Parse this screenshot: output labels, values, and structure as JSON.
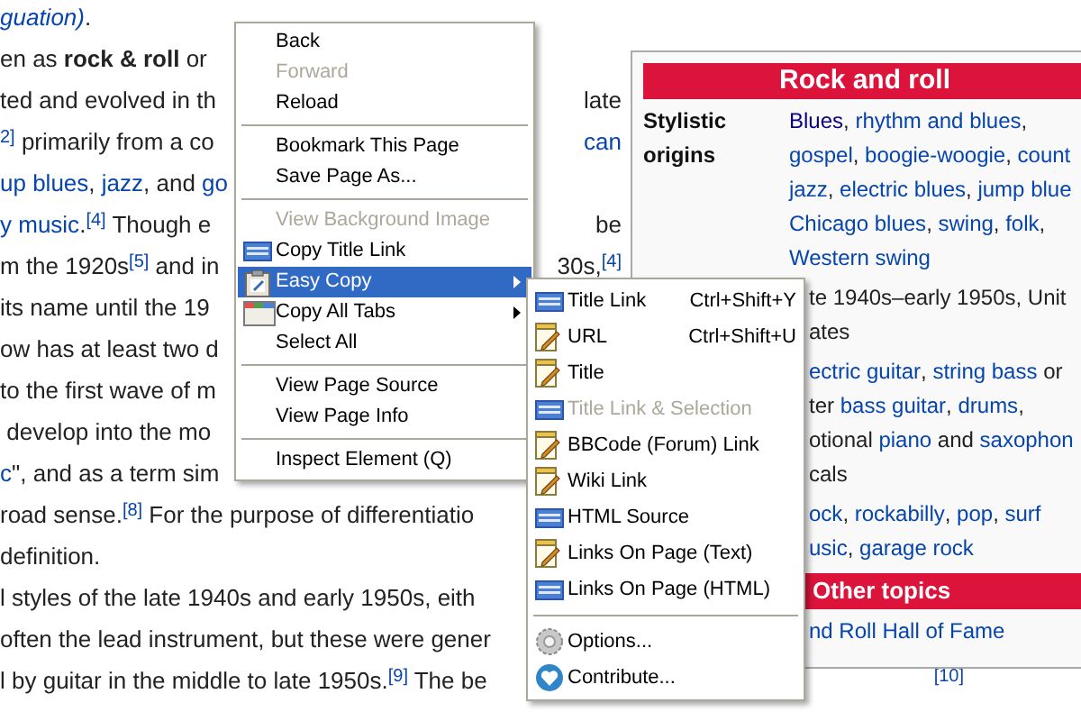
{
  "article": {
    "lines": [
      {
        "segments": [
          {
            "text": "guation)",
            "kind": "italic_link"
          },
          {
            "text": ".",
            "kind": "plain"
          }
        ]
      },
      {
        "segments": [
          {
            "text": "en as ",
            "kind": "plain"
          },
          {
            "text": "rock & roll",
            "kind": "bold"
          },
          {
            "text": " or",
            "kind": "plain"
          }
        ]
      },
      {
        "segments": [
          {
            "text": "ted and evolved in th",
            "kind": "plain"
          }
        ],
        "right": [
          {
            "text": "late",
            "kind": "plain"
          }
        ]
      },
      {
        "segments": [
          {
            "text": "2]",
            "kind": "sup"
          },
          {
            "text": " primarily from a co",
            "kind": "plain"
          }
        ],
        "right": [
          {
            "text": "can",
            "kind": "link"
          }
        ]
      },
      {
        "segments": [
          {
            "text": "up blues",
            "kind": "link"
          },
          {
            "text": ", ",
            "kind": "plain"
          },
          {
            "text": "jazz",
            "kind": "link"
          },
          {
            "text": ", and ",
            "kind": "plain"
          },
          {
            "text": "go",
            "kind": "link"
          }
        ]
      },
      {
        "segments": [
          {
            "text": "y music",
            "kind": "link",
            "after": "."
          },
          {
            "text": "[4]",
            "kind": "sup"
          },
          {
            "text": " Though e",
            "kind": "plain"
          }
        ],
        "right": [
          {
            "text": "be",
            "kind": "plain"
          }
        ]
      },
      {
        "segments": [
          {
            "text": "m the 1920s",
            "kind": "plain"
          },
          {
            "text": "[5]",
            "kind": "sup"
          },
          {
            "text": " and in",
            "kind": "plain"
          }
        ],
        "right": [
          {
            "text": "30s,",
            "kind": "plain"
          },
          {
            "text": "[4]",
            "kind": "sup"
          }
        ]
      },
      {
        "segments": [
          {
            "text": "its name until the 19",
            "kind": "plain"
          }
        ]
      },
      {
        "segments": [
          {
            "text": "ow has at least two d",
            "kind": "plain"
          }
        ]
      },
      {
        "segments": [
          {
            "text": "to the first wave of m",
            "kind": "plain"
          }
        ]
      },
      {
        "segments": [
          {
            "text": " develop into the mo",
            "kind": "plain"
          }
        ]
      },
      {
        "segments": [
          {
            "text": "c",
            "kind": "link"
          },
          {
            "text": "\", and as a term sim",
            "kind": "plain"
          }
        ]
      },
      {
        "segments": [
          {
            "text": "road sense.",
            "kind": "plain"
          },
          {
            "text": "[8]",
            "kind": "sup"
          },
          {
            "text": " For the purpose of differentiatio",
            "kind": "plain"
          }
        ]
      },
      {
        "segments": [
          {
            "text": "definition.",
            "kind": "plain"
          }
        ]
      },
      {
        "segments": [
          {
            "text": "l styles of the late 1940s and early 1950s, eith",
            "kind": "plain"
          }
        ]
      },
      {
        "segments": [
          {
            "text": "often the lead instrument, but these were gener",
            "kind": "plain"
          }
        ]
      }
    ],
    "last_line": {
      "segments": [
        {
          "text": "l by guitar in the middle to late 1950s.",
          "kind": "plain"
        },
        {
          "text": "[9]",
          "kind": "sup"
        },
        {
          "text": " The be",
          "kind": "plain"
        }
      ],
      "right": [
        {
          "text": "[10]",
          "kind": "sup"
        }
      ]
    }
  },
  "infobox": {
    "title": "Rock and roll",
    "rows": [
      {
        "label": "Stylistic origins",
        "lines": [
          [
            {
              "text": "Blues",
              "kind": "visited",
              "after": ", "
            },
            {
              "text": "rhythm and blues",
              "kind": "link",
              "after": ","
            }
          ],
          [
            {
              "text": "gospel",
              "kind": "link",
              "after": ", "
            },
            {
              "text": "boogie-woogie",
              "kind": "link",
              "after": ", "
            },
            {
              "text": "count",
              "kind": "link"
            }
          ],
          [
            {
              "text": "jazz",
              "kind": "link",
              "after": ", "
            },
            {
              "text": "electric blues",
              "kind": "link",
              "after": ", "
            },
            {
              "text": "jump blue",
              "kind": "link"
            }
          ],
          [
            {
              "text": "Chicago blues",
              "kind": "link",
              "after": ", "
            },
            {
              "text": "swing",
              "kind": "link",
              "after": ", "
            },
            {
              "text": "folk",
              "kind": "link",
              "after": ","
            }
          ],
          [
            {
              "text": "Western swing",
              "kind": "link"
            }
          ]
        ]
      },
      {
        "lines": [
          [
            {
              "text": "te 1940s–early 1950s, Unit",
              "kind": "plain"
            }
          ],
          [
            {
              "text": "ates",
              "kind": "plain"
            }
          ]
        ]
      },
      {
        "lines": [
          [
            {
              "text": "ectric guitar",
              "kind": "link"
            },
            {
              "text": ", ",
              "kind": "plain"
            },
            {
              "text": "string bass",
              "kind": "link"
            },
            {
              "text": " or",
              "kind": "plain"
            }
          ],
          [
            {
              "text": "ter ",
              "kind": "plain"
            },
            {
              "text": "bass guitar",
              "kind": "link"
            },
            {
              "text": ", ",
              "kind": "plain"
            },
            {
              "text": "drums",
              "kind": "link"
            },
            {
              "text": ",",
              "kind": "plain"
            }
          ],
          [
            {
              "text": "otional ",
              "kind": "plain"
            },
            {
              "text": "piano",
              "kind": "link"
            },
            {
              "text": " and ",
              "kind": "plain"
            },
            {
              "text": "saxophon",
              "kind": "link"
            }
          ],
          [
            {
              "text": "cals",
              "kind": "plain"
            }
          ]
        ]
      },
      {
        "lines": [
          [
            {
              "text": "ock",
              "kind": "link"
            },
            {
              "text": ", ",
              "kind": "plain"
            },
            {
              "text": "rockabilly",
              "kind": "link"
            },
            {
              "text": ", ",
              "kind": "plain"
            },
            {
              "text": "pop",
              "kind": "link"
            },
            {
              "text": ", ",
              "kind": "plain"
            },
            {
              "text": "surf",
              "kind": "link"
            }
          ],
          [
            {
              "text": "usic",
              "kind": "link"
            },
            {
              "text": ", ",
              "kind": "plain"
            },
            {
              "text": "garage rock",
              "kind": "link"
            }
          ]
        ]
      }
    ],
    "section": "Other topics",
    "section_lines": [
      [
        {
          "text": "nd Roll Hall of Fame",
          "kind": "link"
        }
      ]
    ]
  },
  "context_menu": {
    "items": [
      {
        "kind": "plain",
        "label": "Back",
        "disabled": false,
        "selected": false,
        "submenu": false
      },
      {
        "kind": "plain",
        "label": "Forward",
        "disabled": true,
        "selected": false,
        "submenu": false
      },
      {
        "kind": "plain",
        "label": "Reload",
        "disabled": false,
        "selected": false,
        "submenu": false
      },
      {
        "kind": "separator"
      },
      {
        "kind": "plain",
        "label": "Bookmark This Page",
        "disabled": false,
        "selected": false,
        "submenu": false
      },
      {
        "kind": "plain",
        "label": "Save Page As...",
        "disabled": false,
        "selected": false,
        "submenu": false
      },
      {
        "kind": "separator"
      },
      {
        "kind": "plain",
        "label": "View Background Image",
        "disabled": true,
        "selected": false,
        "submenu": false
      },
      {
        "kind": "html",
        "label": "Copy Title Link",
        "disabled": false,
        "selected": false,
        "submenu": false
      },
      {
        "kind": "clipboard",
        "label": "Easy Copy",
        "disabled": false,
        "selected": true,
        "submenu": true
      },
      {
        "kind": "tabs",
        "label": "Copy All Tabs",
        "disabled": false,
        "selected": false,
        "submenu": true
      },
      {
        "kind": "plain",
        "label": "Select All",
        "disabled": false,
        "selected": false,
        "submenu": false
      },
      {
        "kind": "separator"
      },
      {
        "kind": "plain",
        "label": "View Page Source",
        "disabled": false,
        "selected": false,
        "submenu": false
      },
      {
        "kind": "plain",
        "label": "View Page Info",
        "disabled": false,
        "selected": false,
        "submenu": false
      },
      {
        "kind": "separator"
      },
      {
        "kind": "plain",
        "label": "Inspect Element (Q)",
        "disabled": false,
        "selected": false,
        "submenu": false
      }
    ]
  },
  "submenu": {
    "items": [
      {
        "kind": "html",
        "label": "Title Link",
        "shortcut": "Ctrl+Shift+Y",
        "disabled": false
      },
      {
        "kind": "notepad",
        "label": "URL",
        "shortcut": "Ctrl+Shift+U",
        "disabled": false
      },
      {
        "kind": "notepad",
        "label": "Title",
        "disabled": false
      },
      {
        "kind": "html",
        "label": "Title Link & Selection",
        "disabled": true
      },
      {
        "kind": "notepad",
        "label": "BBCode (Forum) Link",
        "disabled": false
      },
      {
        "kind": "notepad",
        "label": "Wiki Link",
        "disabled": false
      },
      {
        "kind": "html",
        "label": "HTML Source",
        "disabled": false
      },
      {
        "kind": "notepad",
        "label": "Links On Page (Text)",
        "disabled": false
      },
      {
        "kind": "html",
        "label": "Links On Page (HTML)",
        "disabled": false
      },
      {
        "kind": "separator"
      },
      {
        "kind": "gear",
        "label": "Options...",
        "disabled": false
      },
      {
        "kind": "heart",
        "label": "Contribute...",
        "disabled": false
      }
    ]
  }
}
